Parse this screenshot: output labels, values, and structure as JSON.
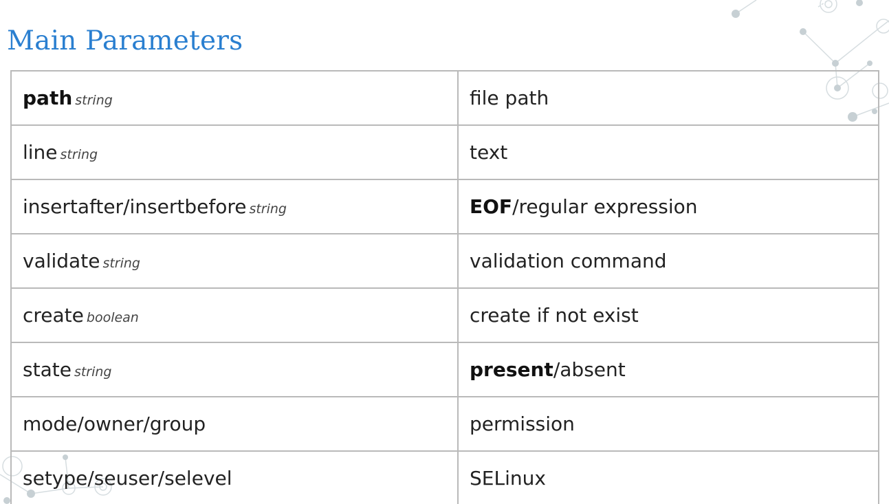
{
  "slide": {
    "title": "Main Parameters",
    "accent_color": "#2a7fd0",
    "decoration_icon": "network-nodes-icon"
  },
  "parameters": [
    {
      "name": "path",
      "name_bold": true,
      "type": "string",
      "desc_bold": "",
      "desc": "file path"
    },
    {
      "name": "line",
      "name_bold": false,
      "type": "string",
      "desc_bold": "",
      "desc": "text"
    },
    {
      "name": "insertafter/insertbefore",
      "name_bold": false,
      "type": "string",
      "desc_bold": "EOF",
      "desc": "/regular expression"
    },
    {
      "name": "validate",
      "name_bold": false,
      "type": "string",
      "desc_bold": "",
      "desc": "validation command"
    },
    {
      "name": "create",
      "name_bold": false,
      "type": "boolean",
      "desc_bold": "",
      "desc": "create if not exist"
    },
    {
      "name": "state",
      "name_bold": false,
      "type": "string",
      "desc_bold": "present",
      "desc": "/absent"
    },
    {
      "name": "mode/owner/group",
      "name_bold": false,
      "type": "",
      "desc_bold": "",
      "desc": "permission"
    },
    {
      "name": "setype/seuser/selevel",
      "name_bold": false,
      "type": "",
      "desc_bold": "",
      "desc": "SELinux"
    }
  ]
}
